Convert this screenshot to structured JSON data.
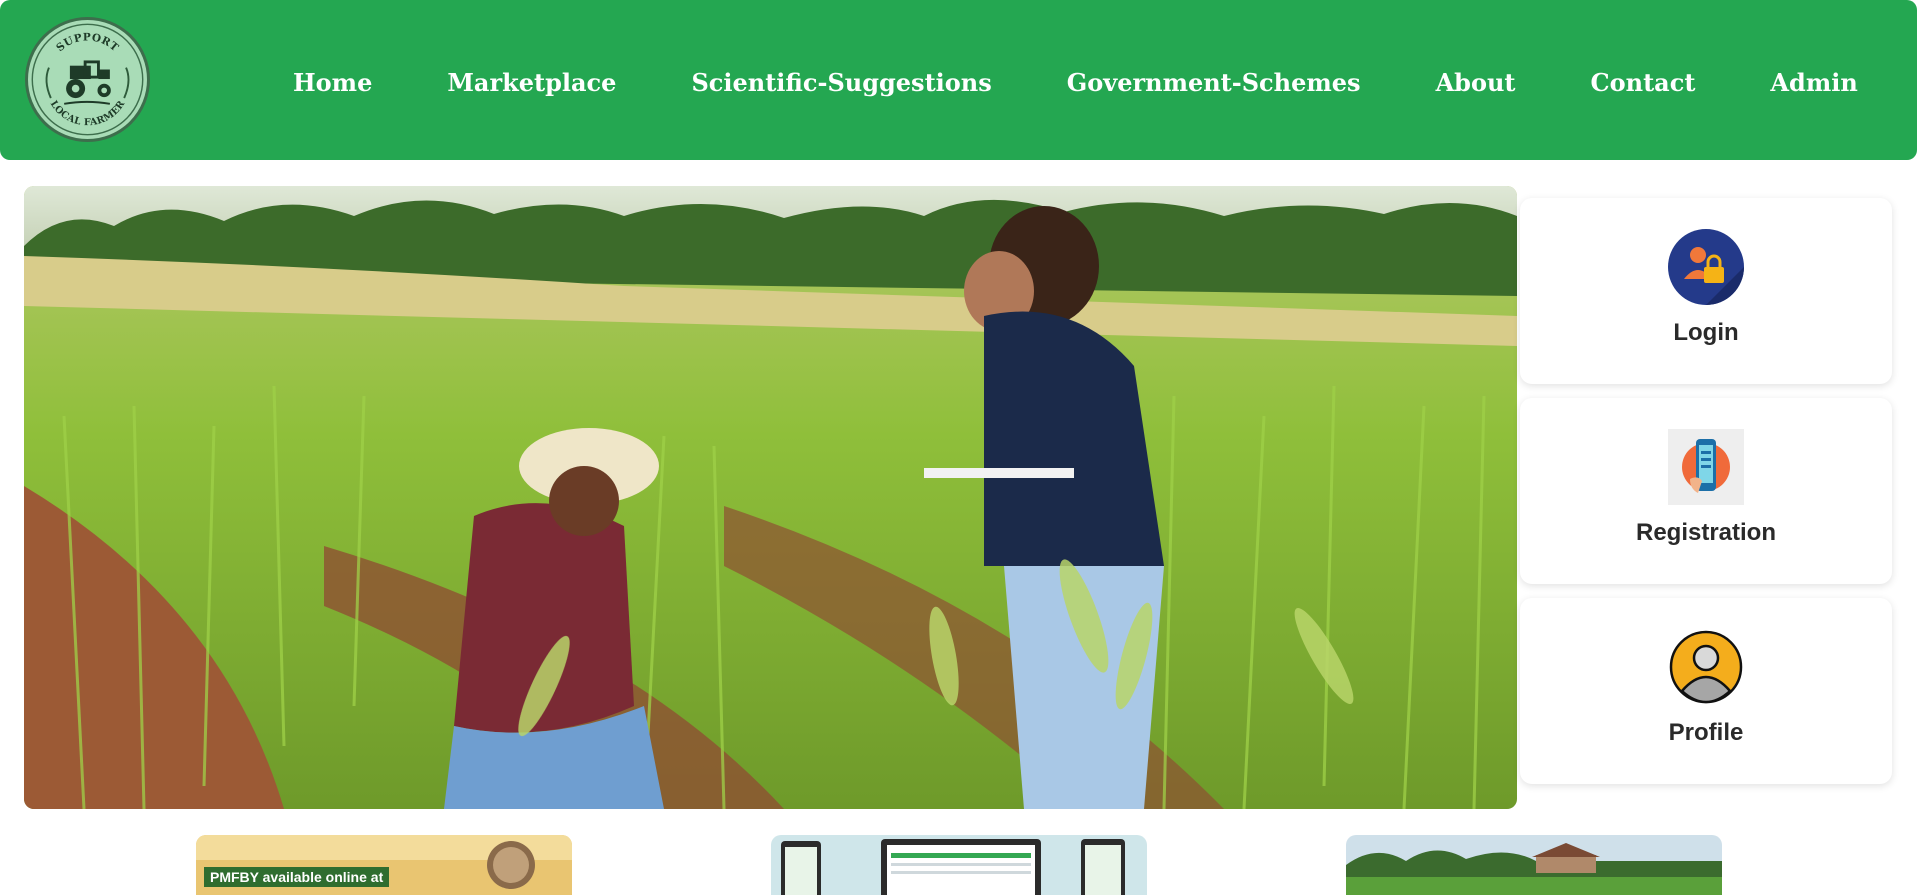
{
  "logo": {
    "text_top": "SUPPORT",
    "text_bottom": "LOCAL FARMER",
    "icon": "tractor-icon"
  },
  "nav": {
    "items": [
      {
        "label": "Home"
      },
      {
        "label": "Marketplace"
      },
      {
        "label": "Scientific-Suggestions"
      },
      {
        "label": "Government-Schemes"
      },
      {
        "label": "About"
      },
      {
        "label": "Contact"
      },
      {
        "label": "Admin"
      }
    ]
  },
  "hero": {
    "image": "field-inspection-photo"
  },
  "cards": [
    {
      "label": "Login",
      "icon": "login-lock-icon"
    },
    {
      "label": "Registration",
      "icon": "registration-phone-icon"
    },
    {
      "label": "Profile",
      "icon": "profile-user-icon"
    }
  ],
  "thumbnails": [
    {
      "caption": "PMFBY available online at",
      "image": "pmfby-banner"
    },
    {
      "image": "mobile-dashboard-banner"
    },
    {
      "image": "farm-village-banner"
    }
  ],
  "colors": {
    "navbar": "#24a751",
    "logo_bg": "#a9dcb7",
    "card_text": "#2a2a2a"
  }
}
